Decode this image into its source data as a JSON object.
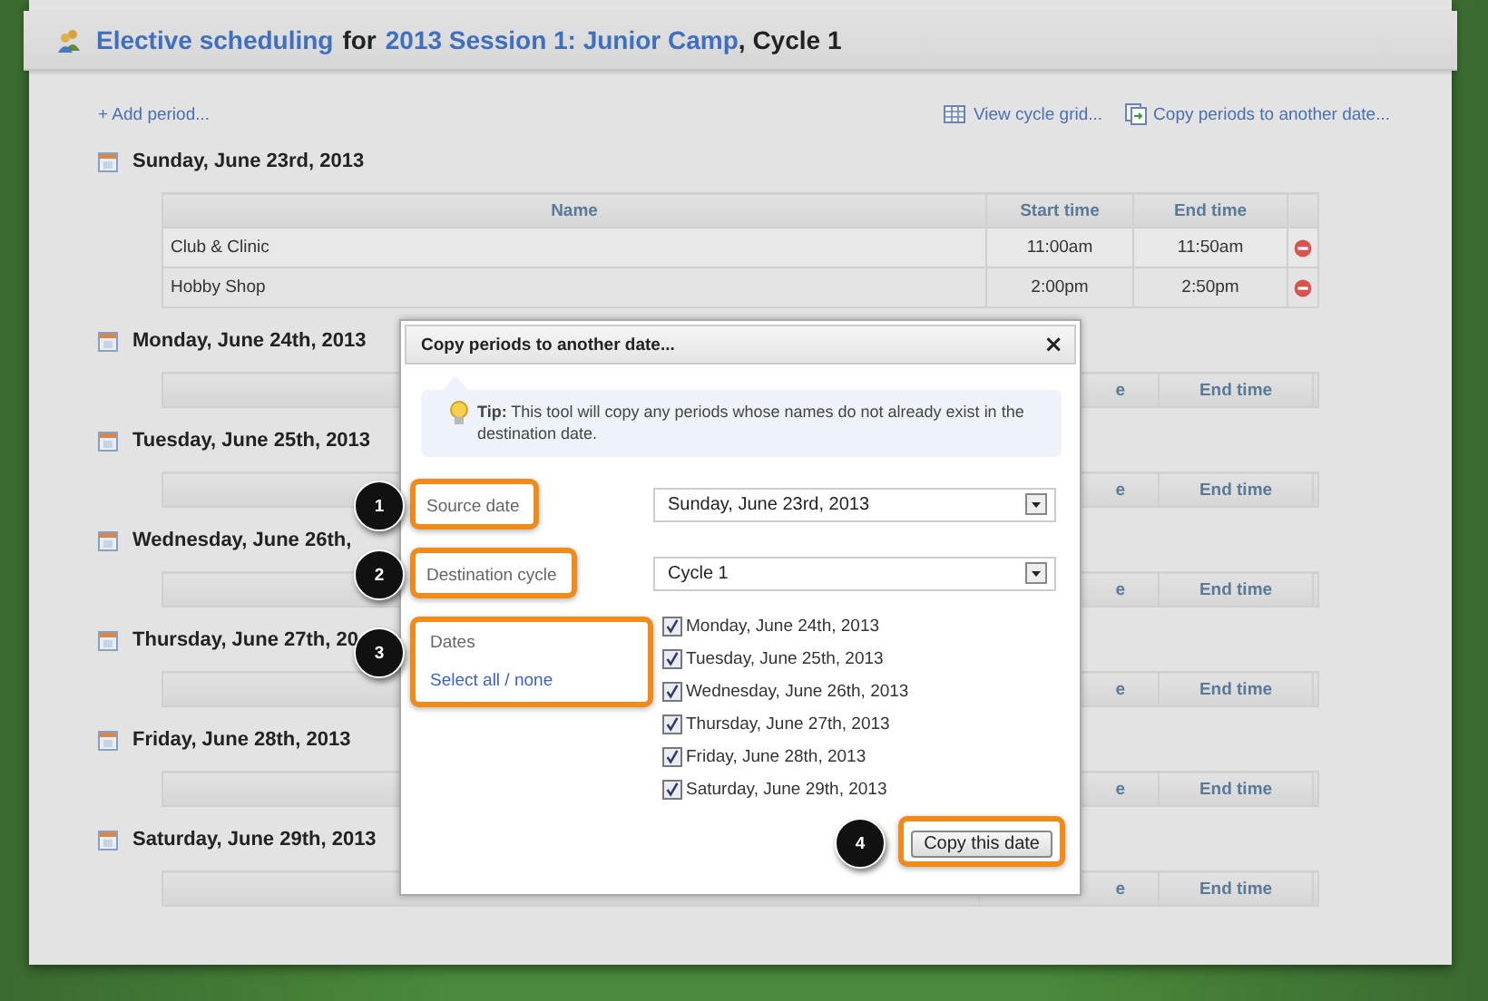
{
  "header": {
    "title_link": "Elective scheduling",
    "title_for": "for",
    "session_link": "2013 Session 1: Junior Camp",
    "title_rest": ", Cycle 1"
  },
  "actions": {
    "add": "+ Add period...",
    "grid": "View cycle grid...",
    "copy": "Copy periods to another date..."
  },
  "days": [
    {
      "heading": "Sunday, June 23rd, 2013",
      "header": {
        "name": "Name",
        "start": "Start time",
        "end": "End time"
      },
      "rows": [
        {
          "name": "Club & Clinic",
          "start": "11:00am",
          "end": "11:50am"
        },
        {
          "name": "Hobby Shop",
          "start": "2:00pm",
          "end": "2:50pm"
        }
      ]
    },
    {
      "heading": "Monday, June 24th, 2013",
      "header": {
        "start": "e",
        "end": "End time"
      }
    },
    {
      "heading": "Tuesday, June 25th, 2013",
      "header": {
        "start": "e",
        "end": "End time"
      }
    },
    {
      "heading": "Wednesday, June 26th,",
      "header": {
        "start": "e",
        "end": "End time"
      }
    },
    {
      "heading": "Thursday, June 27th, 20",
      "header": {
        "start": "e",
        "end": "End time"
      }
    },
    {
      "heading": "Friday, June 28th, 2013",
      "header": {
        "start": "e",
        "end": "End time"
      }
    },
    {
      "heading": "Saturday, June 29th, 2013",
      "header": {
        "start": "e",
        "end": "End time"
      }
    }
  ],
  "dialog": {
    "title": "Copy periods to another date...",
    "close": "×",
    "tip": "**Tip:** This tool will copy any periods whose names do not already exist in the destination date.",
    "source": {
      "label": "Source date",
      "value": "Sunday, June 23rd, 2013",
      "callout": "1"
    },
    "destination": {
      "label": "Destination cycle",
      "value": "Cycle 1",
      "callout": "2"
    },
    "dates_label": "Dates",
    "select_all": "Select all / none",
    "dates_callout": "3",
    "dates": [
      {
        "label": "Monday, June 24th, 2013",
        "checked": true
      },
      {
        "label": "Tuesday, June 25th, 2013",
        "checked": true
      },
      {
        "label": "Wednesday, June 26th, 2013",
        "checked": true
      },
      {
        "label": "Thursday, June 27th, 2013",
        "checked": true
      },
      {
        "label": "Friday, June 28th, 2013",
        "checked": true
      },
      {
        "label": "Saturday, June 29th, 2013",
        "checked": true
      }
    ],
    "button": "Copy this date",
    "button_callout": "4"
  }
}
